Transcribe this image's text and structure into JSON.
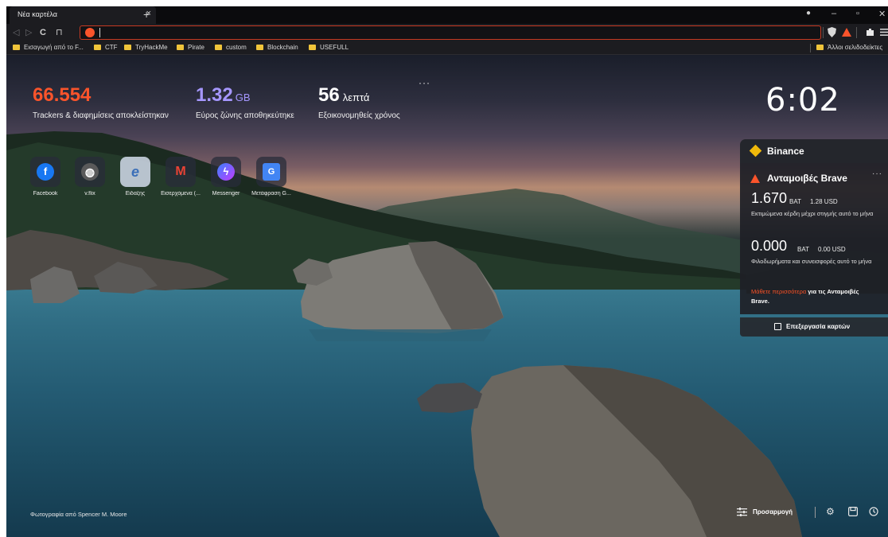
{
  "tab": {
    "title": "Νέα καρτέλα",
    "close": "×",
    "new_tab": "+"
  },
  "window_controls": {
    "profile": "●",
    "minimize": "–",
    "restore": "▫",
    "close": "✕"
  },
  "toolbar": {
    "back": "◁",
    "forward": "▷",
    "reload": "C",
    "bookmark": "⊓",
    "shield_icon": "shield-icon",
    "rewards_icon": "rewards-triangle-icon",
    "extensions_icon": "puzzle-icon",
    "menu_icon": "menu-icon"
  },
  "bookmarks": [
    "Εισαγωγή από το F...",
    "CTF",
    "TryHackMe",
    "Pirate",
    "custom",
    "Blockchain",
    "USEFULL"
  ],
  "other_bookmarks": "Άλλοι σελιδοδείκτες",
  "stats": {
    "trackers": {
      "value": "66.554",
      "label": "Trackers & διαφημίσεις αποκλείστηκαν",
      "color": "#fb542b"
    },
    "bandwidth": {
      "value": "1.32",
      "unit": "GB",
      "label": "Εύρος ζώνης αποθηκεύτηκε",
      "color": "#a697ff"
    },
    "time": {
      "value": "56",
      "unit": "λεπτά",
      "label": "Εξοικονομηθείς χρόνος",
      "color": "#ffffff"
    },
    "menu": "···"
  },
  "clock": "6:02",
  "top_sites": [
    {
      "label": "Facebook",
      "icon": "facebook-icon",
      "glyph": "f",
      "color": "#1877f2"
    },
    {
      "label": "v.flix",
      "icon": "globe-icon",
      "glyph": "◍",
      "color": "#5a5a5a"
    },
    {
      "label": "Είδαξης",
      "icon": "e-logo-icon",
      "glyph": "e",
      "color": "#3b6fb8"
    },
    {
      "label": "Εισερχόμενα (...",
      "icon": "gmail-icon",
      "glyph": "M",
      "color": "#ea4335"
    },
    {
      "label": "Messenger",
      "icon": "messenger-icon",
      "glyph": "ϟ",
      "color": "#a033ff"
    },
    {
      "label": "Μετάφραση G...",
      "icon": "translate-icon",
      "glyph": "G",
      "color": "#4285f4"
    }
  ],
  "binance": {
    "title": "Binance"
  },
  "rewards": {
    "title": "Ανταμοιβές Brave",
    "menu": "···",
    "earnings": {
      "value": "1.670",
      "unit": "BAT",
      "usd": "1.28 USD",
      "desc": "Εκτιμώμενα κέρδη μέχρι στιγμής αυτό το μήνα"
    },
    "tips": {
      "value": "0.000",
      "unit": "BAT",
      "usd": "0.00 USD",
      "desc": "Φιλοδωρήματα και συνεισφορές αυτό το μήνα"
    },
    "learn_link": "Μάθετε περισσότερα",
    "learn_rest": " για τις Ανταμοιβές Brave."
  },
  "edit_cards": "Επεξεργασία καρτών",
  "footer": {
    "credit": "Φωτογραφία από Spencer M. Moore",
    "customize": "Προσαρμογή",
    "settings_icon": "gear-icon",
    "bookmarks_icon": "bookmark-icon",
    "history_icon": "history-icon"
  }
}
